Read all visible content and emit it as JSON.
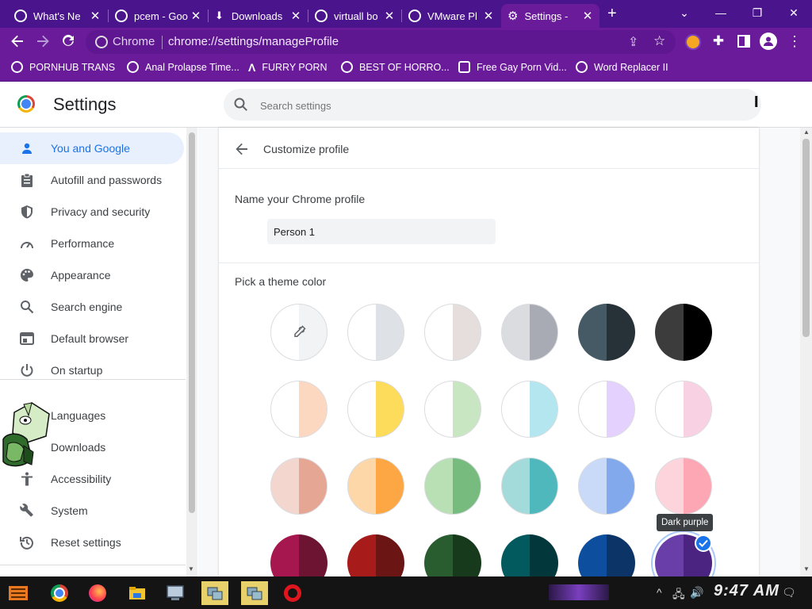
{
  "tabs": [
    {
      "title": "What's Ne",
      "active": false
    },
    {
      "title": "pcem - Goo",
      "active": false
    },
    {
      "title": "Downloads",
      "active": false
    },
    {
      "title": "virtuall bo",
      "active": false
    },
    {
      "title": "VMware Pl",
      "active": false
    },
    {
      "title": "Settings -",
      "active": true
    }
  ],
  "new_tab_glyph": "+",
  "toolbar": {
    "chip": "Chrome",
    "url": "chrome://settings/manageProfile"
  },
  "bookmarks": [
    {
      "label": "PORNHUB TRANS"
    },
    {
      "label": "Anal Prolapse Time..."
    },
    {
      "label": "FURRY PORN"
    },
    {
      "label": "BEST OF HORRO..."
    },
    {
      "label": "Free Gay Porn Vid..."
    },
    {
      "label": "Word Replacer II"
    }
  ],
  "settings": {
    "title": "Settings",
    "search_placeholder": "Search settings"
  },
  "sidebar": {
    "items": [
      {
        "label": "You and Google",
        "icon": "person-icon",
        "active": true
      },
      {
        "label": "Autofill and passwords",
        "icon": "clipboard-icon"
      },
      {
        "label": "Privacy and security",
        "icon": "shield-icon"
      },
      {
        "label": "Performance",
        "icon": "speedometer-icon"
      },
      {
        "label": "Appearance",
        "icon": "palette-icon"
      },
      {
        "label": "Search engine",
        "icon": "search-icon"
      },
      {
        "label": "Default browser",
        "icon": "browser-icon"
      },
      {
        "label": "On startup",
        "icon": "power-icon"
      },
      {
        "label": "Languages",
        "icon": "globe-icon"
      },
      {
        "label": "Downloads",
        "icon": "download-icon"
      },
      {
        "label": "Accessibility",
        "icon": "accessibility-icon"
      },
      {
        "label": "System",
        "icon": "wrench-icon"
      },
      {
        "label": "Reset settings",
        "icon": "history-icon"
      }
    ]
  },
  "profile": {
    "header": "Customize profile",
    "name_label": "Name your Chrome profile",
    "name_value": "Person 1",
    "theme_label": "Pick a theme color",
    "tooltip": "Dark purple"
  },
  "theme_colors": [
    {
      "left": "#ffffff",
      "right": "#f1f3f4",
      "picker": true
    },
    {
      "left": "#ffffff",
      "right": "#dee1e6"
    },
    {
      "left": "#ffffff",
      "right": "#e6dedc"
    },
    {
      "left": "#dadce0",
      "right": "#a8abb3"
    },
    {
      "left": "#455a64",
      "right": "#263238"
    },
    {
      "left": "#3c3c3c",
      "right": "#000000"
    },
    {
      "left": "#ffffff",
      "right": "#fdd8c1"
    },
    {
      "left": "#ffffff",
      "right": "#fddb5b"
    },
    {
      "left": "#ffffff",
      "right": "#c9e6c2"
    },
    {
      "left": "#ffffff",
      "right": "#b3e6ef"
    },
    {
      "left": "#ffffff",
      "right": "#e4d1fd"
    },
    {
      "left": "#ffffff",
      "right": "#f8d2e2"
    },
    {
      "left": "#f3d7ce",
      "right": "#e5a693"
    },
    {
      "left": "#fdd7a8",
      "right": "#fda644"
    },
    {
      "left": "#b9dfb4",
      "right": "#77bc7e"
    },
    {
      "left": "#a3dada",
      "right": "#4eb8bc"
    },
    {
      "left": "#c9daf8",
      "right": "#81a9ec"
    },
    {
      "left": "#fdd4dc",
      "right": "#fda7b4"
    },
    {
      "left": "#a6174f",
      "right": "#6d1432"
    },
    {
      "left": "#a71b1b",
      "right": "#6b1514"
    },
    {
      "left": "#295c2e",
      "right": "#173a1c"
    },
    {
      "left": "#025a5e",
      "right": "#02383b"
    },
    {
      "left": "#0d4f9e",
      "right": "#0d3466"
    },
    {
      "left": "#6a3ea8",
      "right": "#4a2480",
      "selected": true
    }
  ],
  "taskbar": {
    "clock": "9:47 AM"
  },
  "colors": {
    "tabstrip": "#4a148c",
    "toolbar": "#6a1b9a",
    "accent": "#1a73e8"
  }
}
